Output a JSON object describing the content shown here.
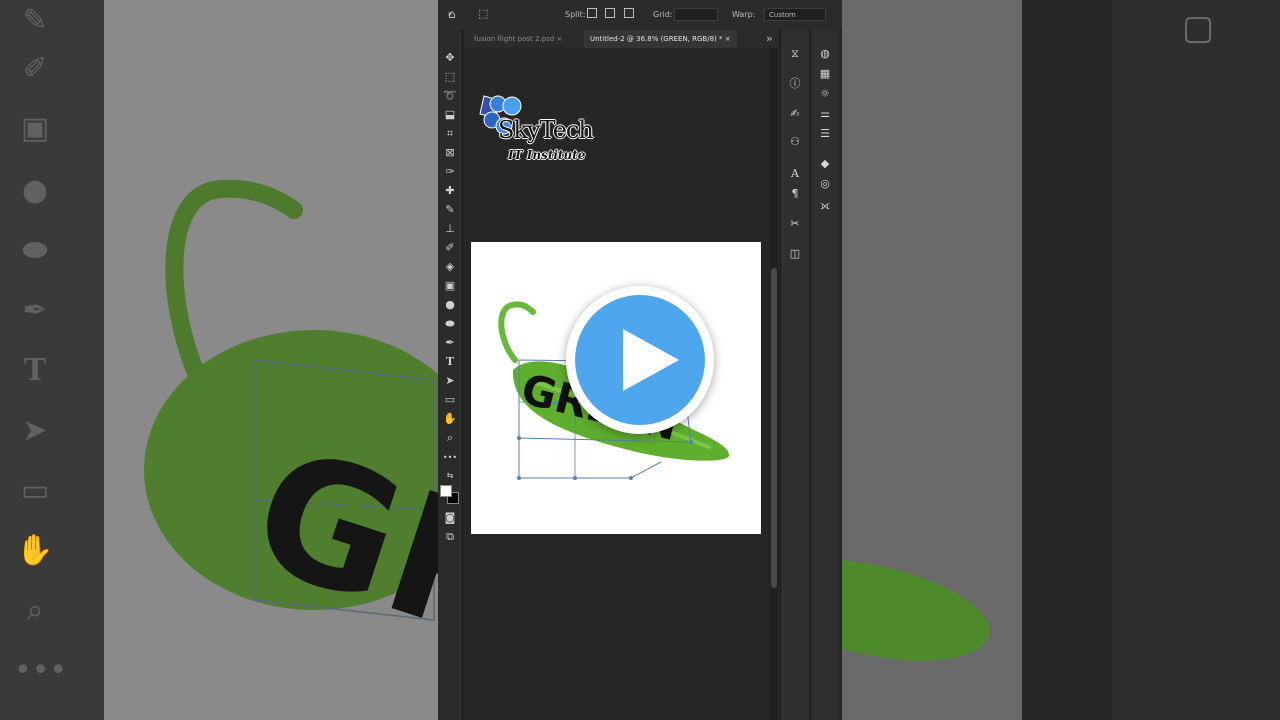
{
  "options_bar": {
    "split_label": "Split:",
    "grid_label": "Grid:",
    "grid_value": "",
    "warp_label": "Warp:",
    "warp_value": "Custom"
  },
  "tabs": [
    {
      "label": "fusion flight  post 2.psd",
      "close": "×"
    },
    {
      "label": "Untitled-2 @ 36.8% (GREEN, RGB/8) *",
      "close": "×"
    }
  ],
  "tab_overflow": "»",
  "logo": {
    "word": "SkyTech",
    "sub": "IT Institute"
  },
  "canvas_text": {
    "pepper_word": "GREEN"
  },
  "background_text": {
    "left_word": "GRE"
  },
  "colors": {
    "play_blue": "#4ea7ee",
    "pepper_green": "#5fae2e"
  },
  "icons": {
    "toolbar": [
      "move-icon",
      "marquee-icon",
      "lasso-icon",
      "object-select-icon",
      "crop-icon",
      "frame-icon",
      "eyedropper-icon",
      "healing-icon",
      "brush-icon",
      "stamp-icon",
      "history-brush-icon",
      "eraser-icon",
      "gradient-icon",
      "blur-icon",
      "dodge-icon",
      "pen-icon",
      "type-icon",
      "path-select-icon",
      "rectangle-icon",
      "hand-icon",
      "zoom-icon",
      "more-icon"
    ],
    "panels": [
      "history-icon",
      "info-icon",
      "brush-settings-icon",
      "clone-source-icon",
      "character-icon",
      "paragraph-icon",
      "tools-icon",
      "adjust-icon"
    ]
  }
}
